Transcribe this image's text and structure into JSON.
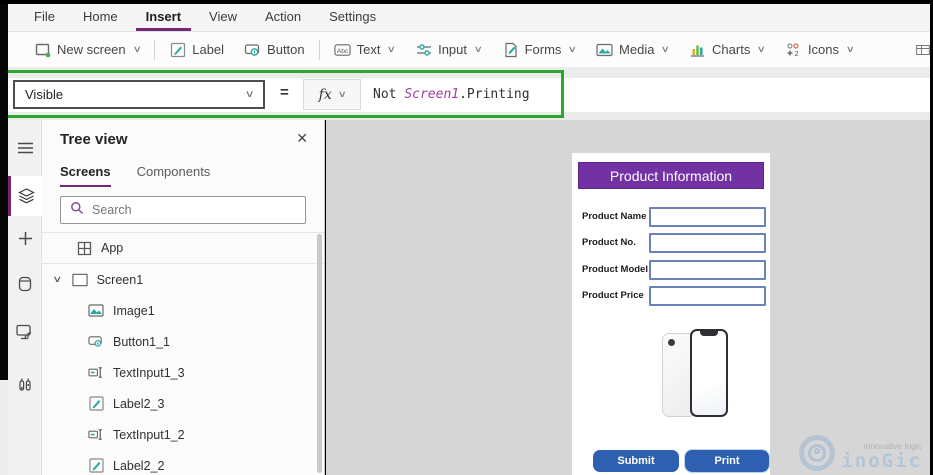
{
  "menu": {
    "items": [
      {
        "label": "File"
      },
      {
        "label": "Home"
      },
      {
        "label": "Insert"
      },
      {
        "label": "View"
      },
      {
        "label": "Action"
      },
      {
        "label": "Settings"
      }
    ],
    "active": "Insert"
  },
  "toolbar": {
    "items": [
      {
        "label": "New screen",
        "icon": "new-screen-icon",
        "chevron": "∨"
      },
      {
        "label": "Label",
        "icon": "label-icon"
      },
      {
        "label": "Button",
        "icon": "button-icon"
      },
      {
        "label": "Text",
        "icon": "text-icon",
        "chevron": "∨"
      },
      {
        "label": "Input",
        "icon": "input-icon",
        "chevron": "∨"
      },
      {
        "label": "Forms",
        "icon": "forms-icon",
        "chevron": "∨"
      },
      {
        "label": "Media",
        "icon": "media-icon",
        "chevron": "∨"
      },
      {
        "label": "Charts",
        "icon": "charts-icon",
        "chevron": "∨"
      },
      {
        "label": "Icons",
        "icon": "icons-icon",
        "chevron": "∨"
      }
    ]
  },
  "formula_bar": {
    "property": "Visible",
    "equals": "=",
    "fx_label": "fx",
    "formula_part1": "Not ",
    "formula_entity": "Screen1",
    "formula_part2": ".Printing",
    "highlight_color": "#2ba52b"
  },
  "left_rail": {
    "icons": [
      "hamburger-icon",
      "tree-view-icon",
      "plus-icon",
      "data-icon",
      "media-screen-icon",
      "advanced-tools-icon"
    ],
    "active": "tree-view-icon"
  },
  "tree_panel": {
    "title": "Tree view",
    "close": "✕",
    "tabs": [
      {
        "label": "Screens"
      },
      {
        "label": "Components"
      }
    ],
    "active_tab": "Screens",
    "search_placeholder": "Search",
    "app_item": "App",
    "screen_item": "Screen1",
    "screen_chevron": "∨",
    "children": [
      "Image1",
      "Button1_1",
      "TextInput1_3",
      "Label2_3",
      "TextInput1_2",
      "Label2_2"
    ]
  },
  "canvas": {
    "form_title": "Product Information",
    "fields": [
      "Product Name",
      "Product No.",
      "Product Model",
      "Product Price"
    ],
    "field_values": [
      "",
      "",
      "",
      ""
    ],
    "buttons": [
      {
        "label": "Submit",
        "selected": false
      },
      {
        "label": "Print",
        "selected": true
      }
    ],
    "header_color": "#7232a3",
    "button_color": "#2e5fb0"
  },
  "watermark": {
    "tagline": "innovative logic",
    "brand": "inoGic"
  }
}
